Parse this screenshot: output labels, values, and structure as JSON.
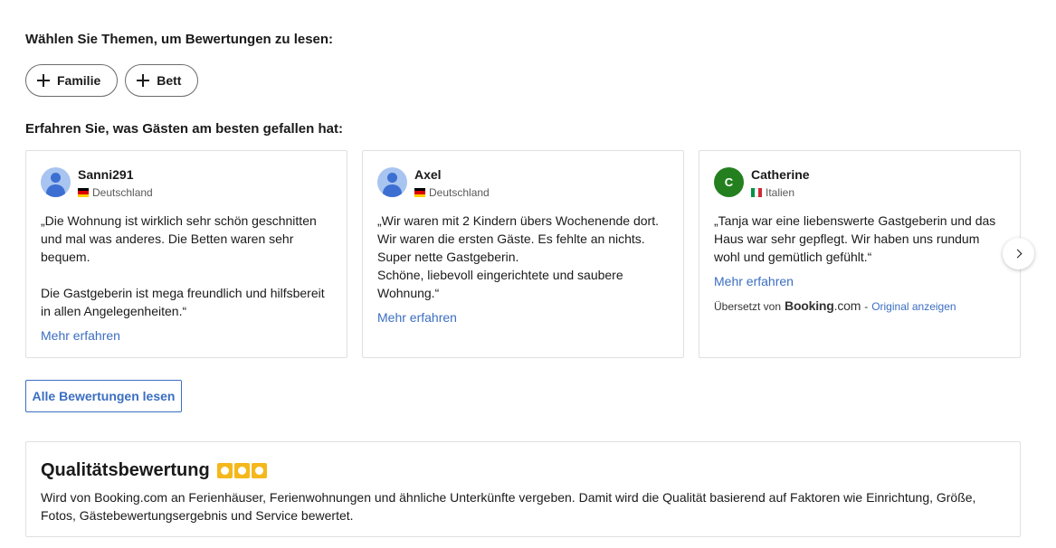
{
  "topics": {
    "heading": "Wählen Sie Themen, um Bewertungen zu lesen:",
    "chips": [
      {
        "label": "Familie",
        "icon": "plus-icon"
      },
      {
        "label": "Bett",
        "icon": "plus-icon"
      }
    ]
  },
  "liked": {
    "heading": "Erfahren Sie, was Gästen am besten gefallen hat:"
  },
  "reviews": [
    {
      "name": "Sanni291",
      "country": "Deutschland",
      "avatar": "person-avatar",
      "text": "„Die Wohnung ist wirklich sehr schön geschnitten und mal was anderes. Die Betten waren sehr bequem.\n\nDie Gastgeberin ist mega freundlich und hilfsbereit in allen Angelegenheiten.“",
      "more": "Mehr erfahren"
    },
    {
      "name": "Axel",
      "country": "Deutschland",
      "avatar": "person-avatar",
      "text": "„Wir waren mit 2 Kindern übers Wochenende dort. Wir waren die ersten Gäste. Es fehlte an nichts. Super nette Gastgeberin.\nSchöne, liebevoll eingerichtete und saubere Wohnung.“",
      "more": "Mehr erfahren"
    },
    {
      "name": "Catherine",
      "country": "Italien",
      "avatar_letter": "C",
      "text": "„Tanja war eine liebenswerte Gastgeberin und das Haus war sehr gepflegt. Wir haben uns rundum wohl und gemütlich gefühlt.“",
      "more": "Mehr erfahren",
      "translated_prefix": "Übersetzt von",
      "translated_brand": "Booking",
      "translated_brand_suffix": ".com",
      "translated_sep": "-",
      "original_link": "Original anzeigen"
    }
  ],
  "all_reviews_button": "Alle Bewertungen lesen",
  "quality": {
    "title": "Qualitätsbewertung",
    "stars": 3,
    "text": "Wird von Booking.com an Ferienhäuser, Ferienwohnungen und ähnliche Unterkünfte vergeben. Damit wird die Qualität basierend auf Faktoren wie Einrichtung, Größe, Fotos, Gästebewertungsergebnis und Service bewertet."
  },
  "colors": {
    "link": "#3b6ec2",
    "star": "#f5b81c",
    "avatar_letter_bg": "#24801f"
  }
}
